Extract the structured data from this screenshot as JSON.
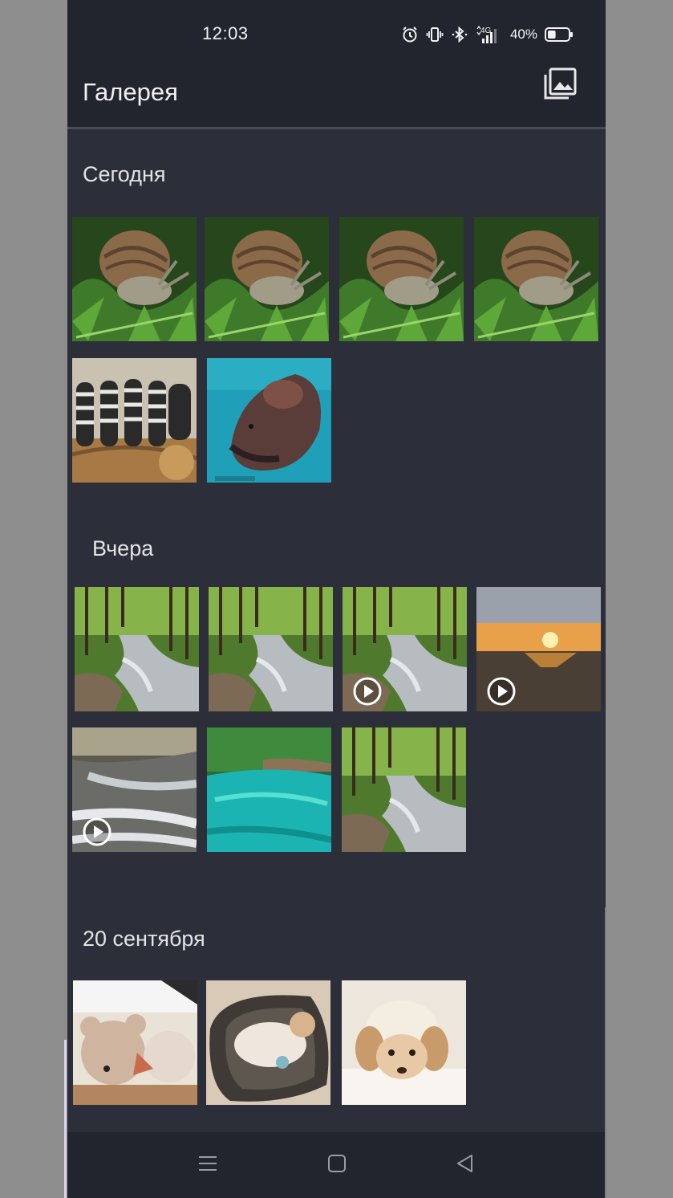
{
  "status_bar": {
    "time": "12:03",
    "network": "4G",
    "battery_percent": "40%",
    "battery_level": 0.4,
    "icons": [
      "alarm-icon",
      "vibrate-icon",
      "bluetooth-icon",
      "signal-icon",
      "battery-icon"
    ]
  },
  "header": {
    "title": "Галерея",
    "albums_icon": "albums-icon"
  },
  "sections": [
    {
      "title": "Сегодня",
      "items": [
        {
          "subject": "snail",
          "video": false
        },
        {
          "subject": "snail",
          "video": false
        },
        {
          "subject": "snail",
          "video": false
        },
        {
          "subject": "snail",
          "video": false
        },
        {
          "subject": "lemurs",
          "video": false
        },
        {
          "subject": "fish",
          "video": false
        }
      ]
    },
    {
      "title": "Вчера",
      "items": [
        {
          "subject": "forest-stream",
          "video": false
        },
        {
          "subject": "forest-stream",
          "video": false
        },
        {
          "subject": "forest-stream",
          "video": true
        },
        {
          "subject": "sunset",
          "video": true
        },
        {
          "subject": "waterfall",
          "video": true
        },
        {
          "subject": "blue-lake",
          "video": false
        },
        {
          "subject": "forest-stream",
          "video": false
        }
      ]
    },
    {
      "title": "20 сентября",
      "items": [
        {
          "subject": "teddy-bear",
          "video": false
        },
        {
          "subject": "dog-in-bed",
          "video": false
        },
        {
          "subject": "dog-closeup",
          "video": false
        }
      ]
    }
  ],
  "nav": {
    "icons": [
      "menu-icon",
      "home-icon",
      "back-icon"
    ]
  },
  "colors": {
    "background": "#2c2f39",
    "bars": "#22252e",
    "text": "#f0f0f0"
  }
}
